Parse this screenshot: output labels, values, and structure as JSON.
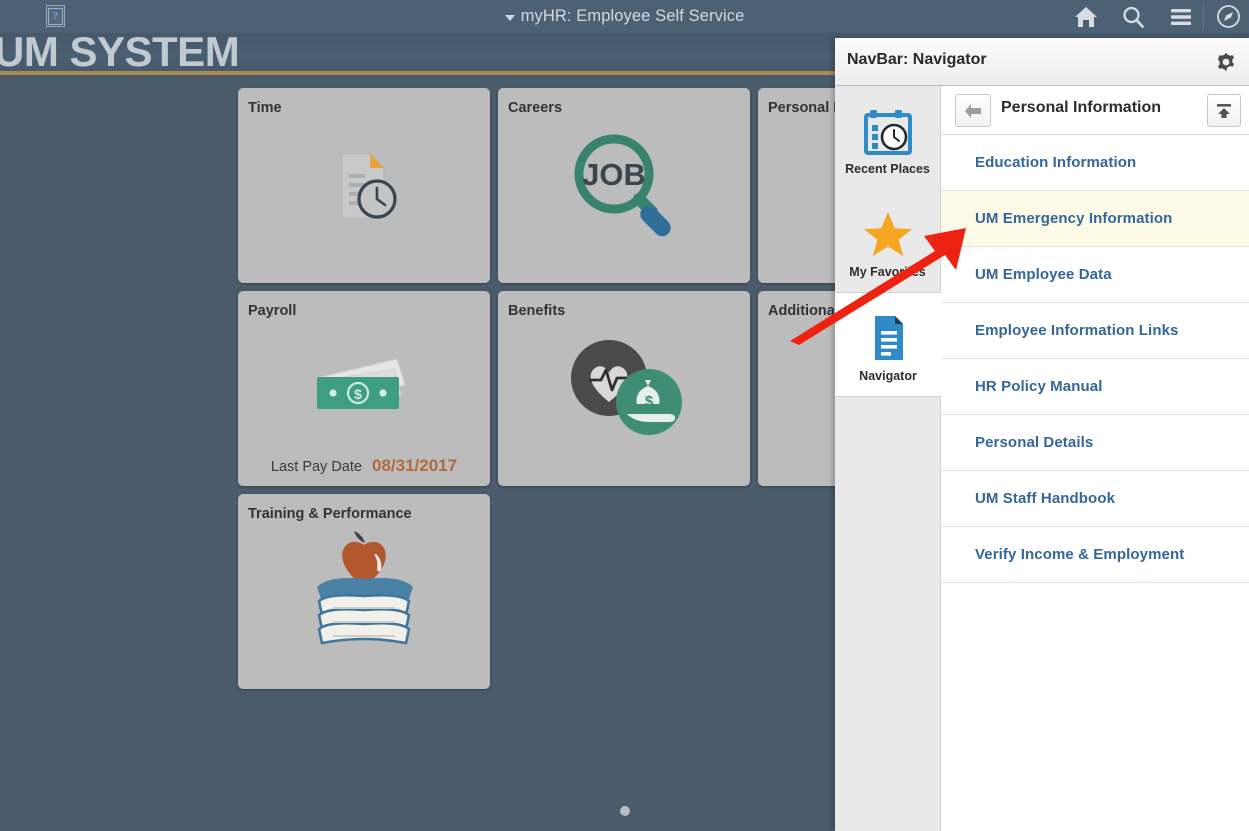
{
  "topbar": {
    "title": "myHR: Employee Self Service",
    "placeholder_icon_glyph": "?",
    "icons": [
      {
        "name": "home-icon",
        "label": "Home"
      },
      {
        "name": "search-icon",
        "label": "Search"
      },
      {
        "name": "actions-list-icon",
        "label": "Actions List"
      },
      {
        "name": "navbar-compass-icon",
        "label": "NavBar"
      }
    ]
  },
  "banner": {
    "text": "UM SYSTEM",
    "rule_color": "#ab8d4f"
  },
  "tiles": [
    [
      {
        "title": "Time",
        "art": "document-clock",
        "footer_label": "",
        "footer_value": ""
      },
      {
        "title": "Careers",
        "art": "job-magnifier",
        "footer_label": "",
        "footer_value": ""
      },
      {
        "title": "Personal I",
        "art": "none",
        "footer_label": "",
        "footer_value": ""
      }
    ],
    [
      {
        "title": "Payroll",
        "art": "money-bills",
        "footer_label": "Last Pay Date",
        "footer_value": "08/31/2017"
      },
      {
        "title": "Benefits",
        "art": "heart-moneybag",
        "footer_label": "",
        "footer_value": ""
      },
      {
        "title": "Additiona",
        "art": "none",
        "footer_label": "",
        "footer_value": ""
      }
    ],
    [
      {
        "title": "Training & Performance",
        "art": "books-apple",
        "footer_label": "",
        "footer_value": ""
      }
    ]
  ],
  "navbar": {
    "panel_title": "NavBar: Navigator",
    "gear_icon": "gear-icon",
    "rail": [
      {
        "label": "Recent Places",
        "icon": "calendar-clock-icon",
        "active": false
      },
      {
        "label": "My Favorites",
        "icon": "star-icon",
        "active": false
      },
      {
        "label": "Navigator",
        "icon": "document-lines-icon",
        "active": true
      }
    ],
    "breadcrumb": {
      "back_icon": "back-arrow-icon",
      "title": "Personal Information",
      "top_icon": "go-to-top-icon"
    },
    "items": [
      {
        "label": "Education Information",
        "highlight": false
      },
      {
        "label": "UM Emergency Information",
        "highlight": true
      },
      {
        "label": "UM Employee Data",
        "highlight": false
      },
      {
        "label": "Employee Information Links",
        "highlight": false
      },
      {
        "label": "HR Policy Manual",
        "highlight": false
      },
      {
        "label": "Personal Details",
        "highlight": false
      },
      {
        "label": "UM Staff Handbook",
        "highlight": false
      },
      {
        "label": "Verify Income & Employment",
        "highlight": false
      }
    ]
  },
  "annotation": {
    "arrow_color": "#ee2211",
    "points_to": "UM Emergency Information"
  },
  "colors": {
    "header_bg": "#4d6175",
    "page_bg": "#4a5b6b",
    "tile_bg": "#bcbcbc",
    "link_blue": "#336699",
    "highlight_row": "#fdfbe8",
    "accent_gold": "#ab8d4f",
    "payroll_value": "#b06a3c"
  }
}
